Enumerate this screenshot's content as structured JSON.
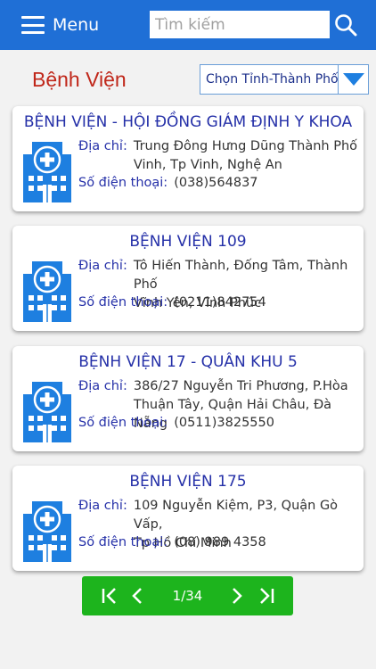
{
  "header": {
    "menu_label": "Menu",
    "search_placeholder": "Tìm kiếm",
    "search_value": ""
  },
  "page": {
    "title": "Bệnh Viện",
    "province_select": "Chọn Tỉnh-Thành Phố"
  },
  "labels": {
    "address": "Địa chỉ:",
    "phone": "Số điện thoại:"
  },
  "hospitals": [
    {
      "name": "BỆNH VIỆN - HỘI ĐỒNG GIÁM ĐỊNH Y KHOA",
      "address_line1": "Trung Đông Hưng Dũng Thành Phố",
      "address_line2": "Vinh, Tp Vinh, Nghệ An",
      "phone": "(038)564837"
    },
    {
      "name": "BỆNH VIỆN 109",
      "address_line1": "Tô Hiến Thành, Đống Tâm, Thành Phố",
      "address_line2": "Vĩnh Yên, Vĩnh Phúc",
      "phone": "(0211)842754"
    },
    {
      "name": "BỆNH VIỆN 17 - QUÂN KHU 5",
      "address_line1": "386/27 Nguyễn Tri Phương, P.Hòa",
      "address_line2": "Thuận Tây, Quận Hải Châu, Đà Nẵng",
      "phone": "(0511)3825550"
    },
    {
      "name": "BỆNH VIỆN 175",
      "address_line1": "109 Nguyễn Kiệm, P3, Quận Gò Vấp,",
      "address_line2": "Tp Hồ Chí Minh",
      "phone": "(08) 989 4358"
    }
  ],
  "pagination": {
    "page_label": "1/34"
  },
  "colors": {
    "header_bg": "#1f6fd6",
    "title_red": "#c0271a",
    "link_blue": "#2530a8",
    "pager_green": "#1db41d",
    "icon_blue": "#1e7fe0"
  }
}
